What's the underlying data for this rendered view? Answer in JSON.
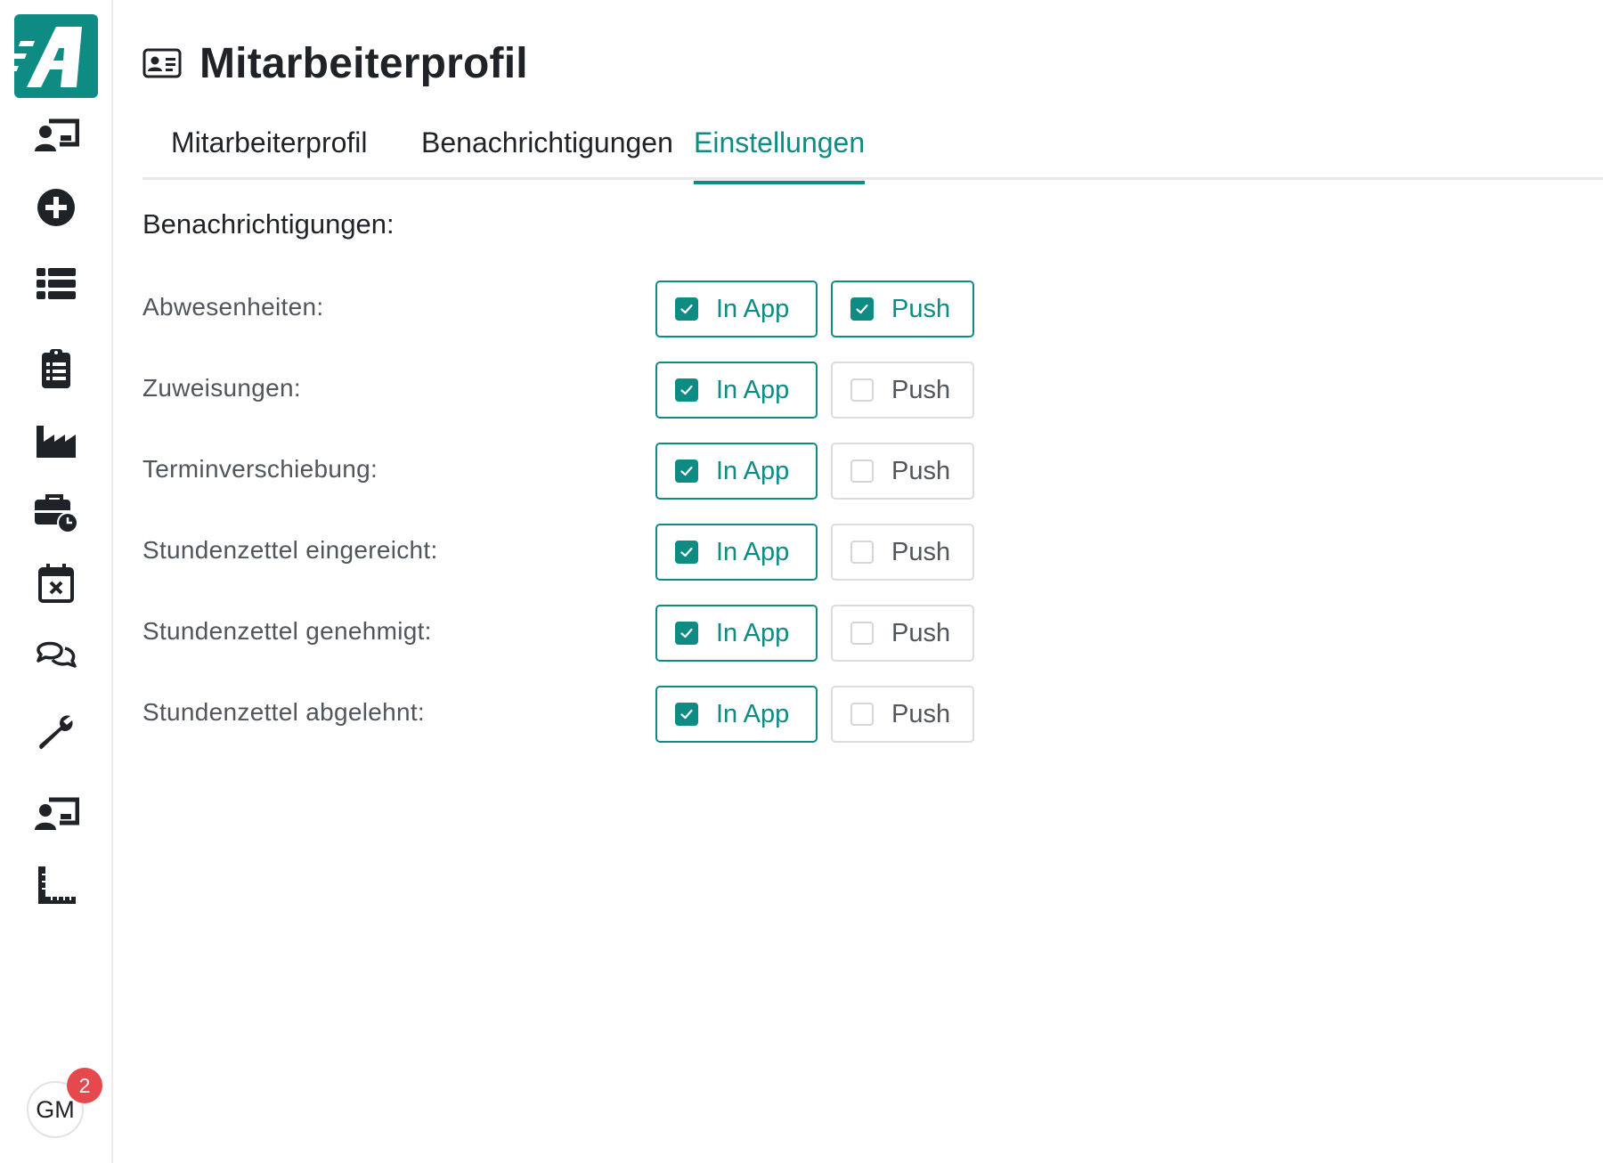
{
  "colors": {
    "accent": "#0e8b83",
    "badge": "#e5484d",
    "text": "#1f2328",
    "muted": "#50565c"
  },
  "sidebar": {
    "items": [
      {
        "icon": "user-board-icon"
      },
      {
        "icon": "plus-circle-icon"
      },
      {
        "icon": "list-icon"
      },
      {
        "icon": "clipboard-list-icon"
      },
      {
        "icon": "factory-icon"
      },
      {
        "icon": "briefcase-clock-icon"
      },
      {
        "icon": "calendar-x-icon"
      },
      {
        "icon": "chat-bubbles-icon"
      },
      {
        "icon": "wrench-icon"
      },
      {
        "icon": "user-board-icon"
      },
      {
        "icon": "ruler-corner-icon"
      }
    ],
    "avatar_initials": "GM",
    "notification_count": "2"
  },
  "header": {
    "title": "Mitarbeiterprofil"
  },
  "tabs": [
    {
      "label": "Mitarbeiterprofil",
      "active": false
    },
    {
      "label": "Benachrichtigungen",
      "active": false
    },
    {
      "label": "Einstellungen",
      "active": true
    }
  ],
  "notifications": {
    "section_title": "Benachrichtigungen:",
    "inapp_label": "In App",
    "push_label": "Push",
    "rows": [
      {
        "label": "Abwesenheiten:",
        "inapp": true,
        "push": true
      },
      {
        "label": "Zuweisungen:",
        "inapp": true,
        "push": false
      },
      {
        "label": "Terminverschiebung:",
        "inapp": true,
        "push": false
      },
      {
        "label": "Stundenzettel eingereicht:",
        "inapp": true,
        "push": false
      },
      {
        "label": "Stundenzettel genehmigt:",
        "inapp": true,
        "push": false
      },
      {
        "label": "Stundenzettel abgelehnt:",
        "inapp": true,
        "push": false
      }
    ]
  }
}
